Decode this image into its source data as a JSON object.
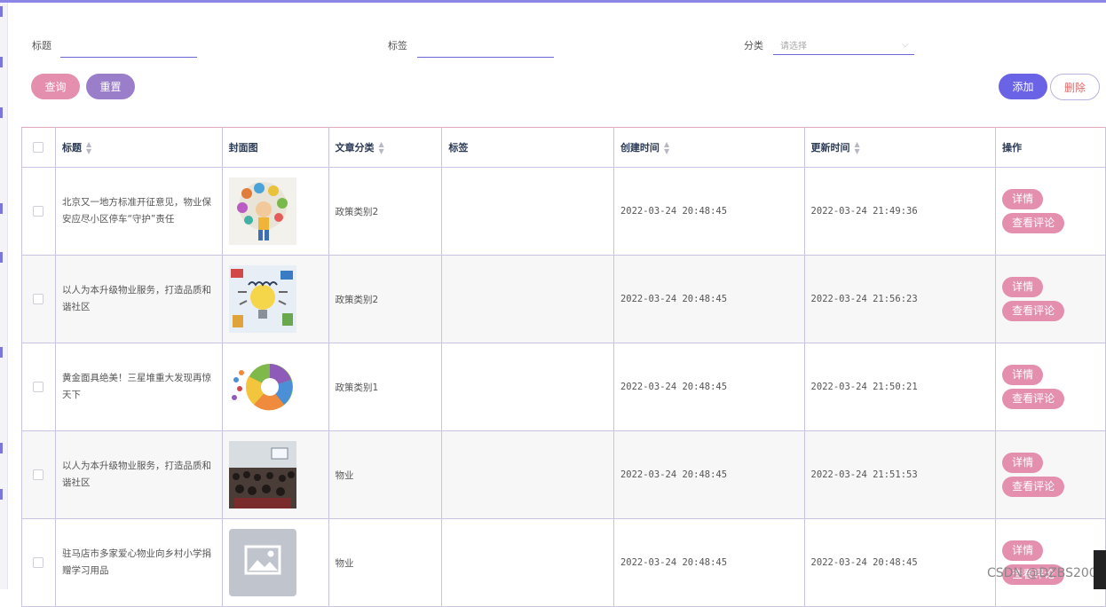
{
  "search": {
    "title_label": "标题",
    "title_value": "",
    "tag_label": "标签",
    "tag_value": "",
    "category_label": "分类",
    "category_placeholder": "请选择"
  },
  "toolbar": {
    "query_label": "查询",
    "reset_label": "重置",
    "add_label": "添加",
    "delete_label": "删除"
  },
  "table": {
    "headers": {
      "title": "标题",
      "cover": "封面图",
      "category": "文章分类",
      "tags": "标签",
      "created": "创建时间",
      "updated": "更新时间",
      "actions": "操作"
    },
    "detail_label": "详情",
    "comment_label": "查看评论",
    "rows": [
      {
        "title": "北京又一地方标准开征意见，物业保安应尽小区停车“守护”责任",
        "category": "政策类别2",
        "tags": "",
        "created": "2022-03-24 20:48:45",
        "updated": "2022-03-24 21:49:36",
        "cover": "cartoon-boy-image"
      },
      {
        "title": "以人为本升级物业服务，打造品质和谐社区",
        "category": "政策类别2",
        "tags": "",
        "created": "2022-03-24 20:48:45",
        "updated": "2022-03-24 21:56:23",
        "cover": "learn-bulb-image"
      },
      {
        "title": "黄金面具绝美！三星堆重大发现再惊天下",
        "category": "政策类别1",
        "tags": "",
        "created": "2022-03-24 20:48:45",
        "updated": "2022-03-24 21:50:21",
        "cover": "circle-diagram-image"
      },
      {
        "title": "以人为本升级物业服务，打造品质和谐社区",
        "category": "物业",
        "tags": "",
        "created": "2022-03-24 20:48:45",
        "updated": "2022-03-24 21:51:53",
        "cover": "meeting-photo-image"
      },
      {
        "title": "驻马店市多家爱心物业向乡村小学捐赠学习用品",
        "category": "物业",
        "tags": "",
        "created": "2022-03-24 20:48:45",
        "updated": "2022-03-24 20:48:45",
        "cover": "placeholder-image"
      }
    ]
  },
  "watermark": "CSDN @DZBS2000",
  "colors": {
    "pink": "#e38fad",
    "purple": "#9b7ec9",
    "indigo": "#6a63e5",
    "danger": "#e06a6a",
    "underline": "#6b66d6"
  }
}
